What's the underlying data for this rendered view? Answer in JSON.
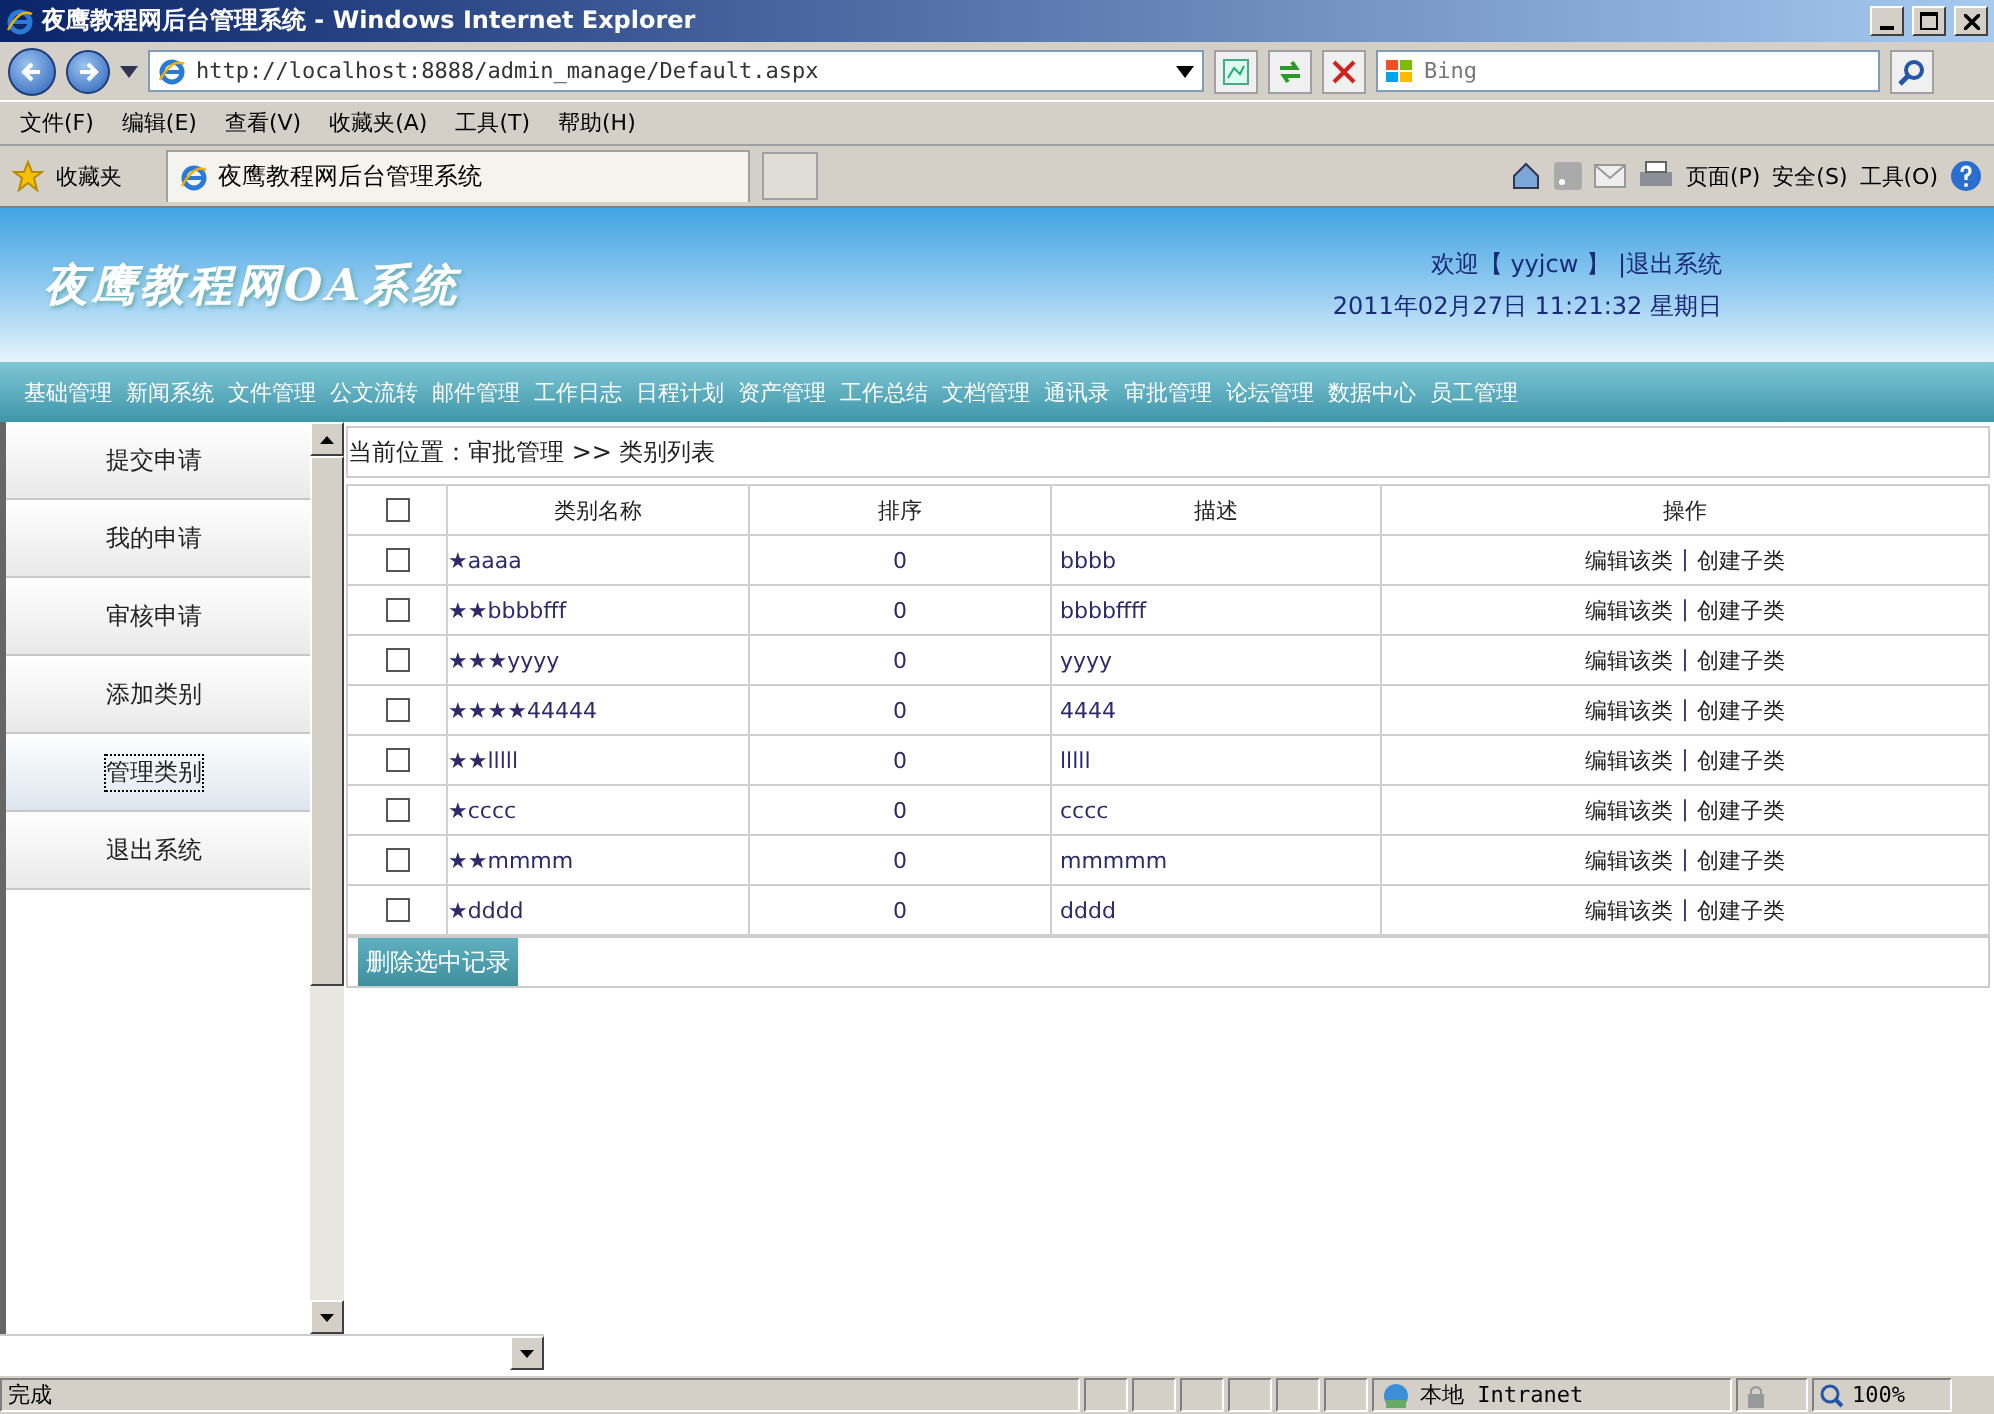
{
  "window": {
    "title": "夜鹰教程网后台管理系统 - Windows Internet Explorer"
  },
  "address_bar": {
    "url": "http://localhost:8888/admin_manage/Default.aspx"
  },
  "search": {
    "placeholder": "Bing"
  },
  "menu": [
    "文件(F)",
    "编辑(E)",
    "查看(V)",
    "收藏夹(A)",
    "工具(T)",
    "帮助(H)"
  ],
  "favorites": {
    "label": "收藏夹",
    "tab": "夜鹰教程网后台管理系统"
  },
  "command_bar": [
    "页面(P)",
    "安全(S)",
    "工具(O)"
  ],
  "header": {
    "logo": "夜鹰教程网OA系统",
    "welcome": "欢迎【 yyjcw 】",
    "logout": "|退出系统",
    "datetime": "2011年02月27日 11:21:32 星期日"
  },
  "nav": [
    "基础管理",
    "新闻系统",
    "文件管理",
    "公文流转",
    "邮件管理",
    "工作日志",
    "日程计划",
    "资产管理",
    "工作总结",
    "文档管理",
    "通讯录",
    "审批管理",
    "论坛管理",
    "数据中心",
    "员工管理"
  ],
  "sidebar": [
    {
      "label": "提交申请",
      "selected": false
    },
    {
      "label": "我的申请",
      "selected": false
    },
    {
      "label": "审核申请",
      "selected": false
    },
    {
      "label": "添加类别",
      "selected": false
    },
    {
      "label": "管理类别",
      "selected": true
    },
    {
      "label": "退出系统",
      "selected": false
    }
  ],
  "breadcrumb": "当前位置：审批管理 >> 类别列表",
  "table": {
    "header_checked": false,
    "columns": [
      "类别名称",
      "排序",
      "描述",
      "操作"
    ],
    "action_separator": "|",
    "rows": [
      {
        "checked": false,
        "name": "★aaaa",
        "order": "0",
        "description": "bbbb",
        "actions": [
          "编辑该类",
          "创建子类"
        ]
      },
      {
        "checked": false,
        "name": "★★bbbbfff",
        "order": "0",
        "description": "bbbbffff",
        "actions": [
          "编辑该类",
          "创建子类"
        ]
      },
      {
        "checked": false,
        "name": "★★★yyyy",
        "order": "0",
        "description": "yyyy",
        "actions": [
          "编辑该类",
          "创建子类"
        ]
      },
      {
        "checked": false,
        "name": "★★★★44444",
        "order": "0",
        "description": "4444",
        "actions": [
          "编辑该类",
          "创建子类"
        ]
      },
      {
        "checked": false,
        "name": "★★lllll",
        "order": "0",
        "description": "lllll",
        "actions": [
          "编辑该类",
          "创建子类"
        ]
      },
      {
        "checked": false,
        "name": "★cccc",
        "order": "0",
        "description": "cccc",
        "actions": [
          "编辑该类",
          "创建子类"
        ]
      },
      {
        "checked": false,
        "name": "★★mmmm",
        "order": "0",
        "description": "mmmmm",
        "actions": [
          "编辑该类",
          "创建子类"
        ]
      },
      {
        "checked": false,
        "name": "★dddd",
        "order": "0",
        "description": "dddd",
        "actions": [
          "编辑该类",
          "创建子类"
        ]
      }
    ]
  },
  "delete_button": "删除选中记录",
  "status_bar": {
    "text": "完成",
    "zone": "本地 Intranet",
    "zoom": "100%"
  }
}
